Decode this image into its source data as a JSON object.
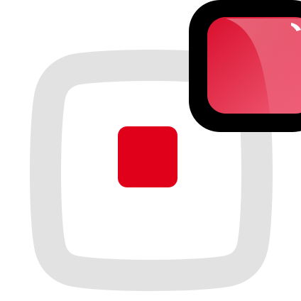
{
  "icon": {
    "kind": "stop-record-button-icon",
    "colors": {
      "background": "#ffffff",
      "frame": "#e2e2e2",
      "center_square": "#e0001a",
      "badge_outline": "#000000",
      "badge_red_dark": "#d90f2d",
      "badge_red_light": "#f05f79",
      "highlight": "#ffffff"
    }
  }
}
